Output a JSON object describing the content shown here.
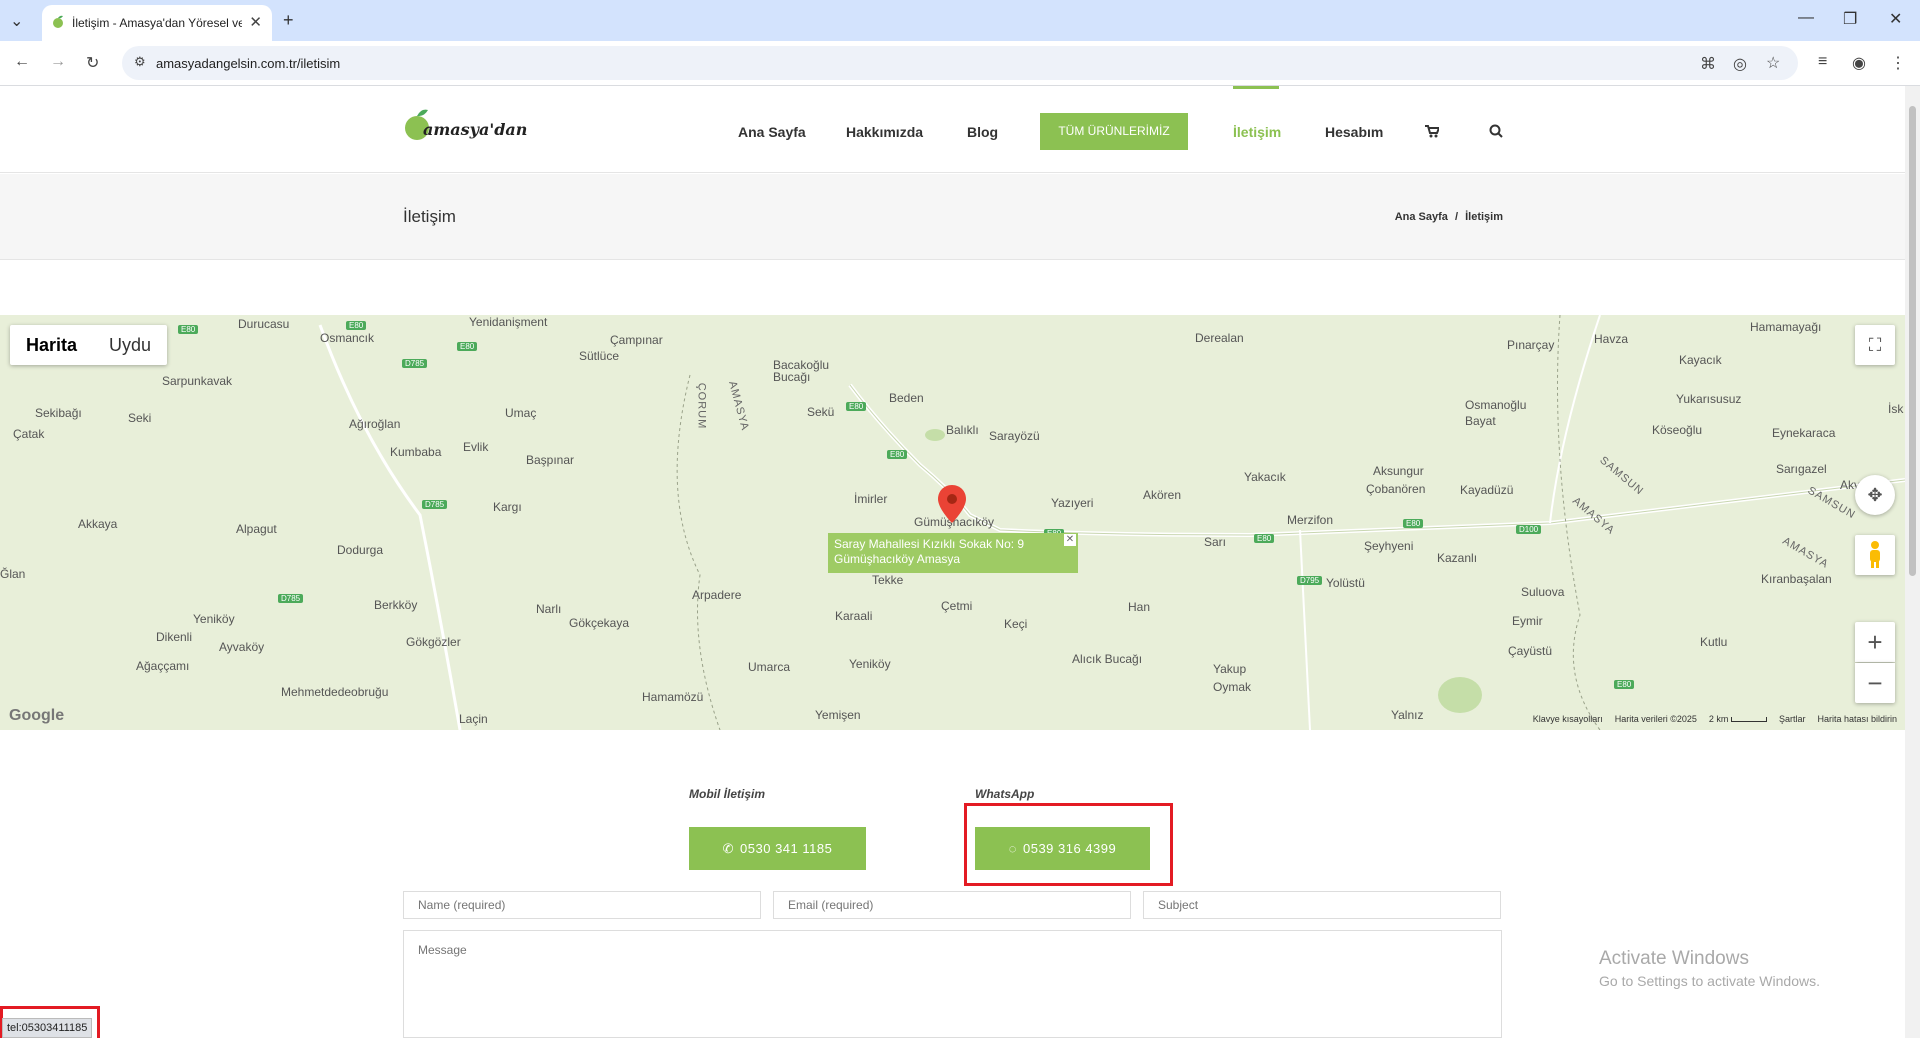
{
  "browser": {
    "tab_title": "İletişim - Amasya'dan Yöresel ve",
    "url": "amasyadangelsin.com.tr/iletisim"
  },
  "site": {
    "logo_text": "amasya'dan",
    "nav": [
      {
        "label": "Ana Sayfa"
      },
      {
        "label": "Hakkımızda"
      },
      {
        "label": "Blog"
      },
      {
        "label": "TÜM ÜRÜNLERİMİZ"
      },
      {
        "label": "İletişim"
      },
      {
        "label": "Hesabım"
      }
    ],
    "brand_color": "#8cc152"
  },
  "page": {
    "title": "İletişim",
    "breadcrumb": [
      "Ana Sayfa",
      "/",
      "İletişim"
    ]
  },
  "map": {
    "type_buttons": [
      "Harita",
      "Uydu"
    ],
    "info_text": "Saray Mahallesi Kızıklı Sokak No: 9 Gümüşhacıköy Amasya",
    "labels": [
      "Yenidanişment",
      "Durucasu",
      "Osmancık",
      "Çampınar",
      "Sütlüce",
      "Derealan",
      "Pınarçay",
      "Havza",
      "Hamamayağı",
      "Kayacık",
      "Sarpunkavak",
      "Bacakoğlu Bucağı",
      "Beden",
      "Sekü",
      "Sekibağı",
      "Seki",
      "Çatak",
      "Ağıroğlan",
      "Umaç",
      "Balıklı",
      "Sarayözü",
      "Osmanoğlu Bayat",
      "Yukarısusuz",
      "Köseoğlu",
      "Eynekaraca",
      "Kumbaba",
      "Evlik",
      "Başpınar",
      "Yakacık",
      "Aksungur",
      "Çobanören",
      "Kayadüzü",
      "Sarıgazel",
      "Kargı",
      "İmirler",
      "Gümüşhacıköy",
      "Yazıyeri",
      "Akören",
      "Merzifon",
      "Akkaya",
      "Alpagut",
      "Sarı",
      "Şeyhyeni",
      "Kazanlı",
      "Kıranbaşalan",
      "Dodurga",
      "Tekke",
      "Yolüstü",
      "Suluova",
      "Berkköy",
      "Narlı",
      "Arpadere",
      "Çetmi",
      "Han",
      "Yeniköy",
      "Gökçekaya",
      "Karaali",
      "Keçi",
      "Eymir",
      "Kutlu",
      "Dikenli",
      "Ayvaköy",
      "Gökgözler",
      "Çayüstü",
      "Ağaççamı",
      "Umarca",
      "Yeniköy",
      "Alıcık Bucağı",
      "Yakup Oymak",
      "Mehmetdedeobruğu",
      "Hamamözü",
      "Yemişen",
      "Laçin",
      "Yalnız",
      "ÇORUM",
      "AMASYA",
      "SAMSUN",
      "AMASYA",
      "SAMSUN",
      "AMASYA",
      "Ğlan",
      "İsk",
      "Akv",
      "Sarı"
    ],
    "shields": [
      "E80",
      "E80",
      "D785",
      "E80",
      "E80",
      "E80",
      "D785",
      "E80",
      "E80",
      "E80",
      "D100",
      "D795",
      "D785",
      "E80"
    ],
    "footer": [
      "Klavye kısayolları",
      "Harita verileri ©2025",
      "2 km",
      "Şartlar",
      "Harita hatası bildirin"
    ],
    "google_logo": "Google",
    "zoom_in": "+",
    "zoom_out": "−"
  },
  "contact": {
    "mobile_label": "Mobil İletişim",
    "mobile_number": "0530 341 1185",
    "whatsapp_label": "WhatsApp",
    "whatsapp_number": "0539 316 4399"
  },
  "form": {
    "name_placeholder": "Name (required)",
    "email_placeholder": "Email (required)",
    "subject_placeholder": "Subject",
    "message_placeholder": "Message"
  },
  "status_bar": "tel:05303411185",
  "watermark": {
    "line1": "Activate Windows",
    "line2": "Go to Settings to activate Windows."
  }
}
